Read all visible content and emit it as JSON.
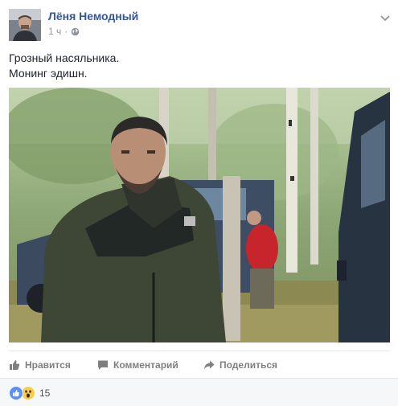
{
  "post": {
    "author": "Лёня Немодный",
    "time": "1 ч",
    "time_separator": "·",
    "privacy_icon": "globe-icon",
    "menu_icon": "chevron-down-icon",
    "text_lines": [
      "Грозный насяльника.",
      "Монинг эдишн."
    ]
  },
  "actions": {
    "like_label": "Нравится",
    "comment_label": "Комментарий",
    "share_label": "Поделиться"
  },
  "reactions": {
    "icons": [
      "like-reaction-icon",
      "wow-reaction-icon"
    ],
    "count": "15"
  },
  "colors": {
    "link": "#365899",
    "meta": "#90949c",
    "action": "#7f7f7f",
    "like_blue": "#5890ff",
    "wow_yellow": "#f7cd4a"
  }
}
